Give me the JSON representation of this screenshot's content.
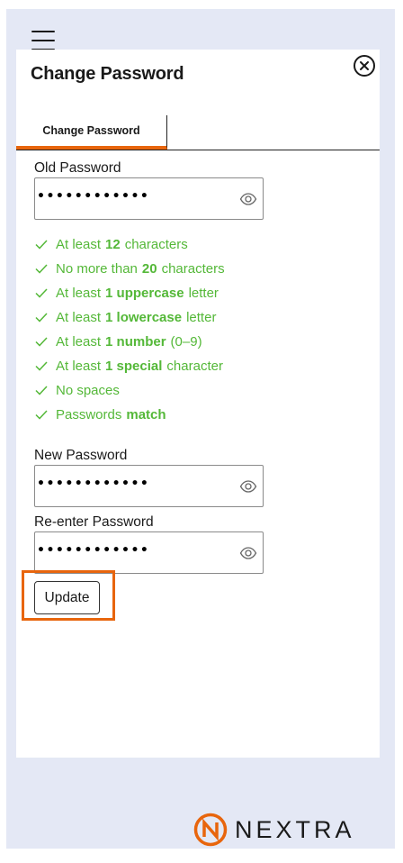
{
  "app": {
    "brand_name": "NEXTRA",
    "accent_color": "#e8650d",
    "success_color": "#54b838"
  },
  "header": {
    "menu_icon": "hamburger-icon"
  },
  "dialog": {
    "title": "Change Password",
    "close_icon": "close-circle-icon",
    "tabs": [
      {
        "label": "Change Password",
        "active": true
      }
    ]
  },
  "form": {
    "old_password": {
      "label": "Old Password",
      "value": "••••••••••••"
    },
    "new_password": {
      "label": "New Password",
      "value": "••••••••••••"
    },
    "reenter_password": {
      "label": "Re-enter Password",
      "value": "••••••••••••"
    },
    "submit_label": "Update"
  },
  "rules": [
    {
      "pre": "At least",
      "strong": "12",
      "post": "characters"
    },
    {
      "pre": "No more than",
      "strong": "20",
      "post": "characters"
    },
    {
      "pre": "At least",
      "strong": "1 uppercase",
      "post": "letter"
    },
    {
      "pre": "At least",
      "strong": "1 lowercase",
      "post": "letter"
    },
    {
      "pre": "At least",
      "strong": "1 number",
      "post": "(0–9)"
    },
    {
      "pre": "At least",
      "strong": "1 special",
      "post": "character"
    },
    {
      "pre": "No spaces",
      "strong": "",
      "post": ""
    },
    {
      "pre": "Passwords",
      "strong": "match",
      "post": ""
    }
  ]
}
